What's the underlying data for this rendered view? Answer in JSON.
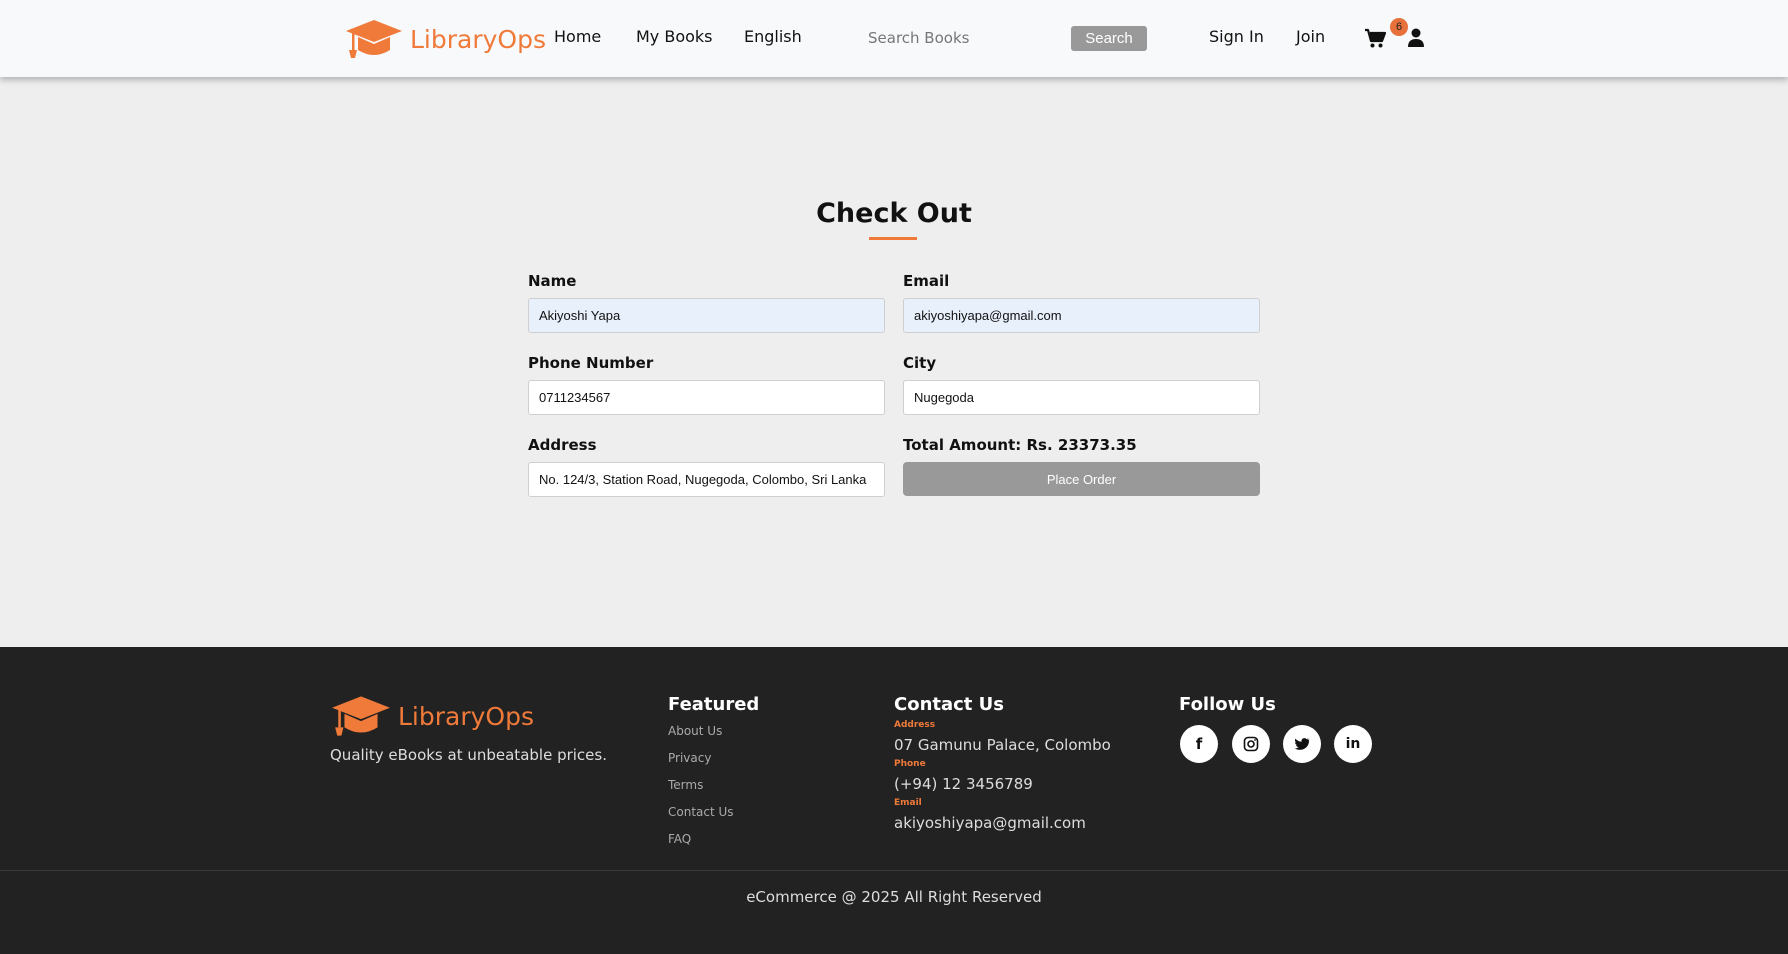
{
  "brand": {
    "name": "LibraryOps",
    "accent": "#f07a3a"
  },
  "nav": {
    "home": "Home",
    "my_books": "My Books",
    "language": "English",
    "search_placeholder": "Search Books",
    "search_button": "Search",
    "sign_in": "Sign In",
    "join": "Join",
    "cart_count": "6"
  },
  "checkout": {
    "title": "Check Out",
    "name_label": "Name",
    "name_value": "Akiyoshi Yapa",
    "email_label": "Email",
    "email_value": "akiyoshiyapa@gmail.com",
    "phone_label": "Phone Number",
    "phone_value": "0711234567",
    "city_label": "City",
    "city_value": "Nugegoda",
    "address_label": "Address",
    "address_value": "No. 124/3, Station Road, Nugegoda, Colombo, Sri Lanka",
    "total_label": "Total Amount: Rs. 23373.35",
    "place_order": "Place Order"
  },
  "footer": {
    "brand": "LibraryOps",
    "tagline": "Quality eBooks at unbeatable prices.",
    "featured_heading": "Featured",
    "featured_links": [
      "About Us",
      "Privacy",
      "Terms",
      "Contact Us",
      "FAQ"
    ],
    "contact_heading": "Contact Us",
    "address_label": "Address",
    "address_value": "07 Gamunu Palace, Colombo",
    "phone_label": "Phone",
    "phone_value": "(+94) 12 3456789",
    "email_label": "Email",
    "email_value": "akiyoshiyapa@gmail.com",
    "follow_heading": "Follow Us",
    "social_icons": [
      "facebook-icon",
      "instagram-icon",
      "twitter-icon",
      "linkedin-icon"
    ],
    "copyright": "eCommerce @ 2025 All Right Reserved"
  }
}
